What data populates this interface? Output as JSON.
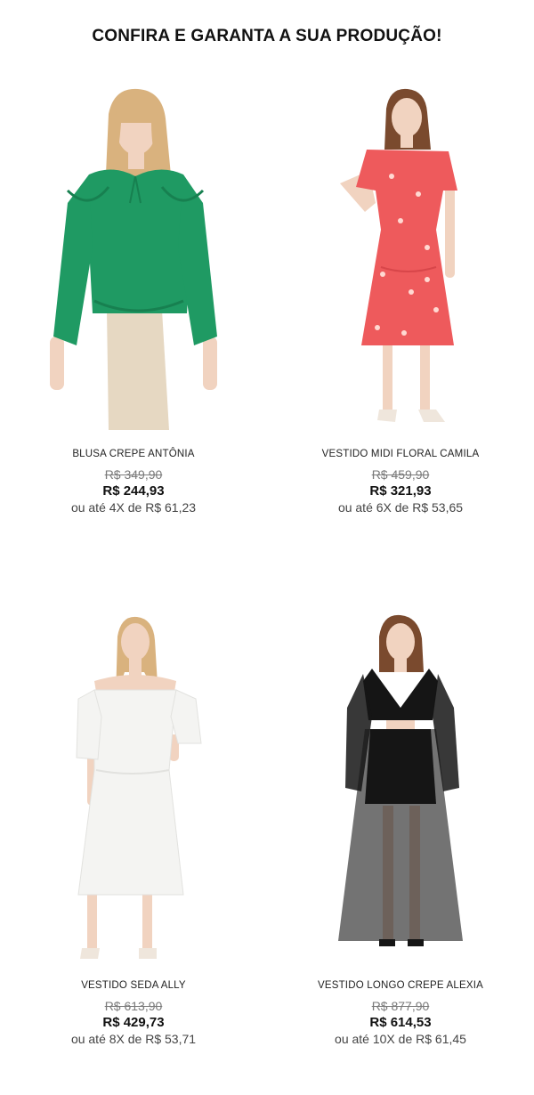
{
  "header": {
    "title": "CONFIRA E GARANTA A SUA PRODUÇÃO!"
  },
  "products": [
    {
      "name": "BLUSA CREPE ANTÔNIA",
      "old_price": "R$ 349,90",
      "price": "R$ 244,93",
      "installments": "ou até 4X de R$ 61,23",
      "colors": {
        "garment": "#1f9a63",
        "lower": "#e6d8c2"
      }
    },
    {
      "name": "VESTIDO MIDI FLORAL CAMILA",
      "old_price": "R$ 459,90",
      "price": "R$ 321,93",
      "installments": "ou até 6X de R$ 53,65",
      "colors": {
        "garment": "#ee5a5c"
      }
    },
    {
      "name": "VESTIDO SEDA ALLY",
      "old_price": "R$ 613,90",
      "price": "R$ 429,73",
      "installments": "ou até 8X de R$ 53,71",
      "colors": {
        "garment": "#f4f4f2"
      }
    },
    {
      "name": "VESTIDO LONGO CREPE ALEXIA",
      "old_price": "R$ 877,90",
      "price": "R$ 614,53",
      "installments": "ou até 10X de R$ 61,45",
      "colors": {
        "garment": "#151515"
      }
    }
  ],
  "colors": {
    "skin": "#f1d3c0",
    "hair_blonde": "#d9b27e",
    "hair_brown": "#7a4a2e",
    "text": "#111111",
    "muted": "#7a7a7a"
  }
}
